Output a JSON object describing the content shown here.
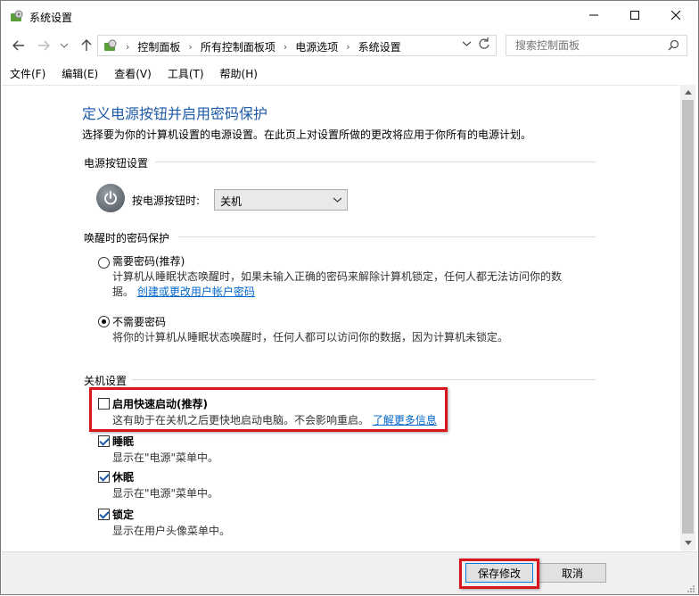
{
  "window": {
    "title": "系统设置",
    "controls": {
      "minimize": "—",
      "maximize": "☐",
      "close": "✕"
    }
  },
  "navigation": {
    "back_icon": "arrow-left-icon",
    "forward_icon": "arrow-right-icon",
    "recent_icon": "chevron-down-icon",
    "up_icon": "arrow-up-icon",
    "breadcrumbs": [
      "控制面板",
      "所有控制面板项",
      "电源选项",
      "系统设置"
    ],
    "search_placeholder": "搜索控制面板"
  },
  "menu": {
    "items": [
      "文件(F)",
      "编辑(E)",
      "查看(V)",
      "工具(T)",
      "帮助(H)"
    ]
  },
  "main": {
    "title": "定义电源按钮并启用密码保护",
    "description": "选择要为你的计算机设置的电源设置。在此页上对设置所做的更改将应用于你所有的电源计划。",
    "power_group": {
      "heading": "电源按钮设置",
      "label": "按电源按钮时:",
      "selected": "关机"
    },
    "password_group": {
      "heading": "唤醒时的密码保护",
      "options": [
        {
          "label": "需要密码(推荐)",
          "desc_line1": "计算机从睡眠状态唤醒时，如果未输入正确的密码来解除计算机锁定，任何人都无法访问你的数",
          "desc_line2": "据。",
          "link": "创建或更改用户帐户密码",
          "checked": false
        },
        {
          "label": "不需要密码",
          "desc_line1": "将你的计算机从睡眠状态唤醒时，任何人都可以访问你的数据，因为计算机未锁定。",
          "checked": true
        }
      ]
    },
    "shutdown_group": {
      "heading": "关机设置",
      "items": [
        {
          "label": "启用快速启动(推荐)",
          "desc": "这有助于在关机之后更快地启动电脑。不会影响重启。",
          "link": "了解更多信息",
          "checked": false
        },
        {
          "label": "睡眠",
          "desc": "显示在\"电源\"菜单中。",
          "checked": true
        },
        {
          "label": "休眠",
          "desc": "显示在\"电源\"菜单中。",
          "checked": true
        },
        {
          "label": "锁定",
          "desc": "显示在用户头像菜单中。",
          "checked": true
        }
      ]
    }
  },
  "footer": {
    "save": "保存修改",
    "cancel": "取消"
  },
  "colors": {
    "title_blue": "#1e5aa8",
    "link_blue": "#0066cc",
    "highlight_red": "#d9161c"
  }
}
